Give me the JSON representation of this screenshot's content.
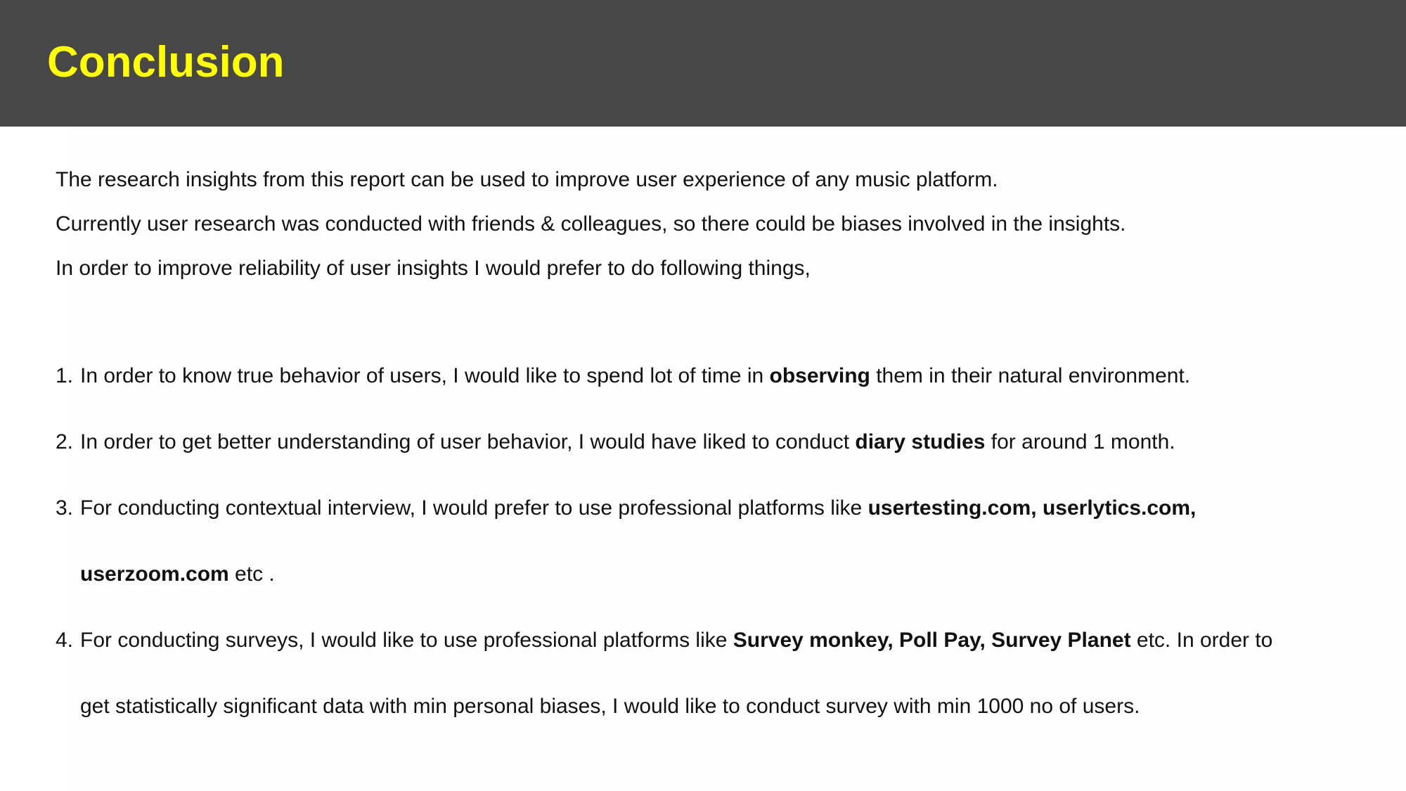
{
  "slide": {
    "title": "Conclusion",
    "title_color": "#ffff00",
    "header_bg": "#474747",
    "intro": [
      "The research insights from this report can be used to improve user experience of any music platform.",
      "Currently user research was conducted with friends & colleagues, so there could be biases involved in the insights.",
      "In order to improve reliability of user insights I would prefer to do following things,"
    ],
    "items": [
      {
        "num": "1.",
        "pre": "In order to know true behavior of users, I would like to spend lot of time in ",
        "bold": "observing",
        "post": " them in their natural environment."
      },
      {
        "num": "2.",
        "pre": "In order to get better understanding of user behavior, I would have liked to conduct ",
        "bold": "diary studies",
        "post": " for around 1 month."
      },
      {
        "num": "3.",
        "pre": "For conducting contextual interview, I would prefer to use professional platforms like ",
        "bold": "usertesting.com, userlytics.com,",
        "bold2": "userzoom.com",
        "post": " etc ."
      },
      {
        "num": "4.",
        "pre": "For conducting surveys, I would like to use professional platforms like ",
        "bold": "Survey monkey, Poll Pay, Survey Planet",
        "post": " etc. In order to",
        "line2": "get statistically significant data with min personal biases,  I would like to conduct survey with min 1000 no of users."
      }
    ]
  }
}
